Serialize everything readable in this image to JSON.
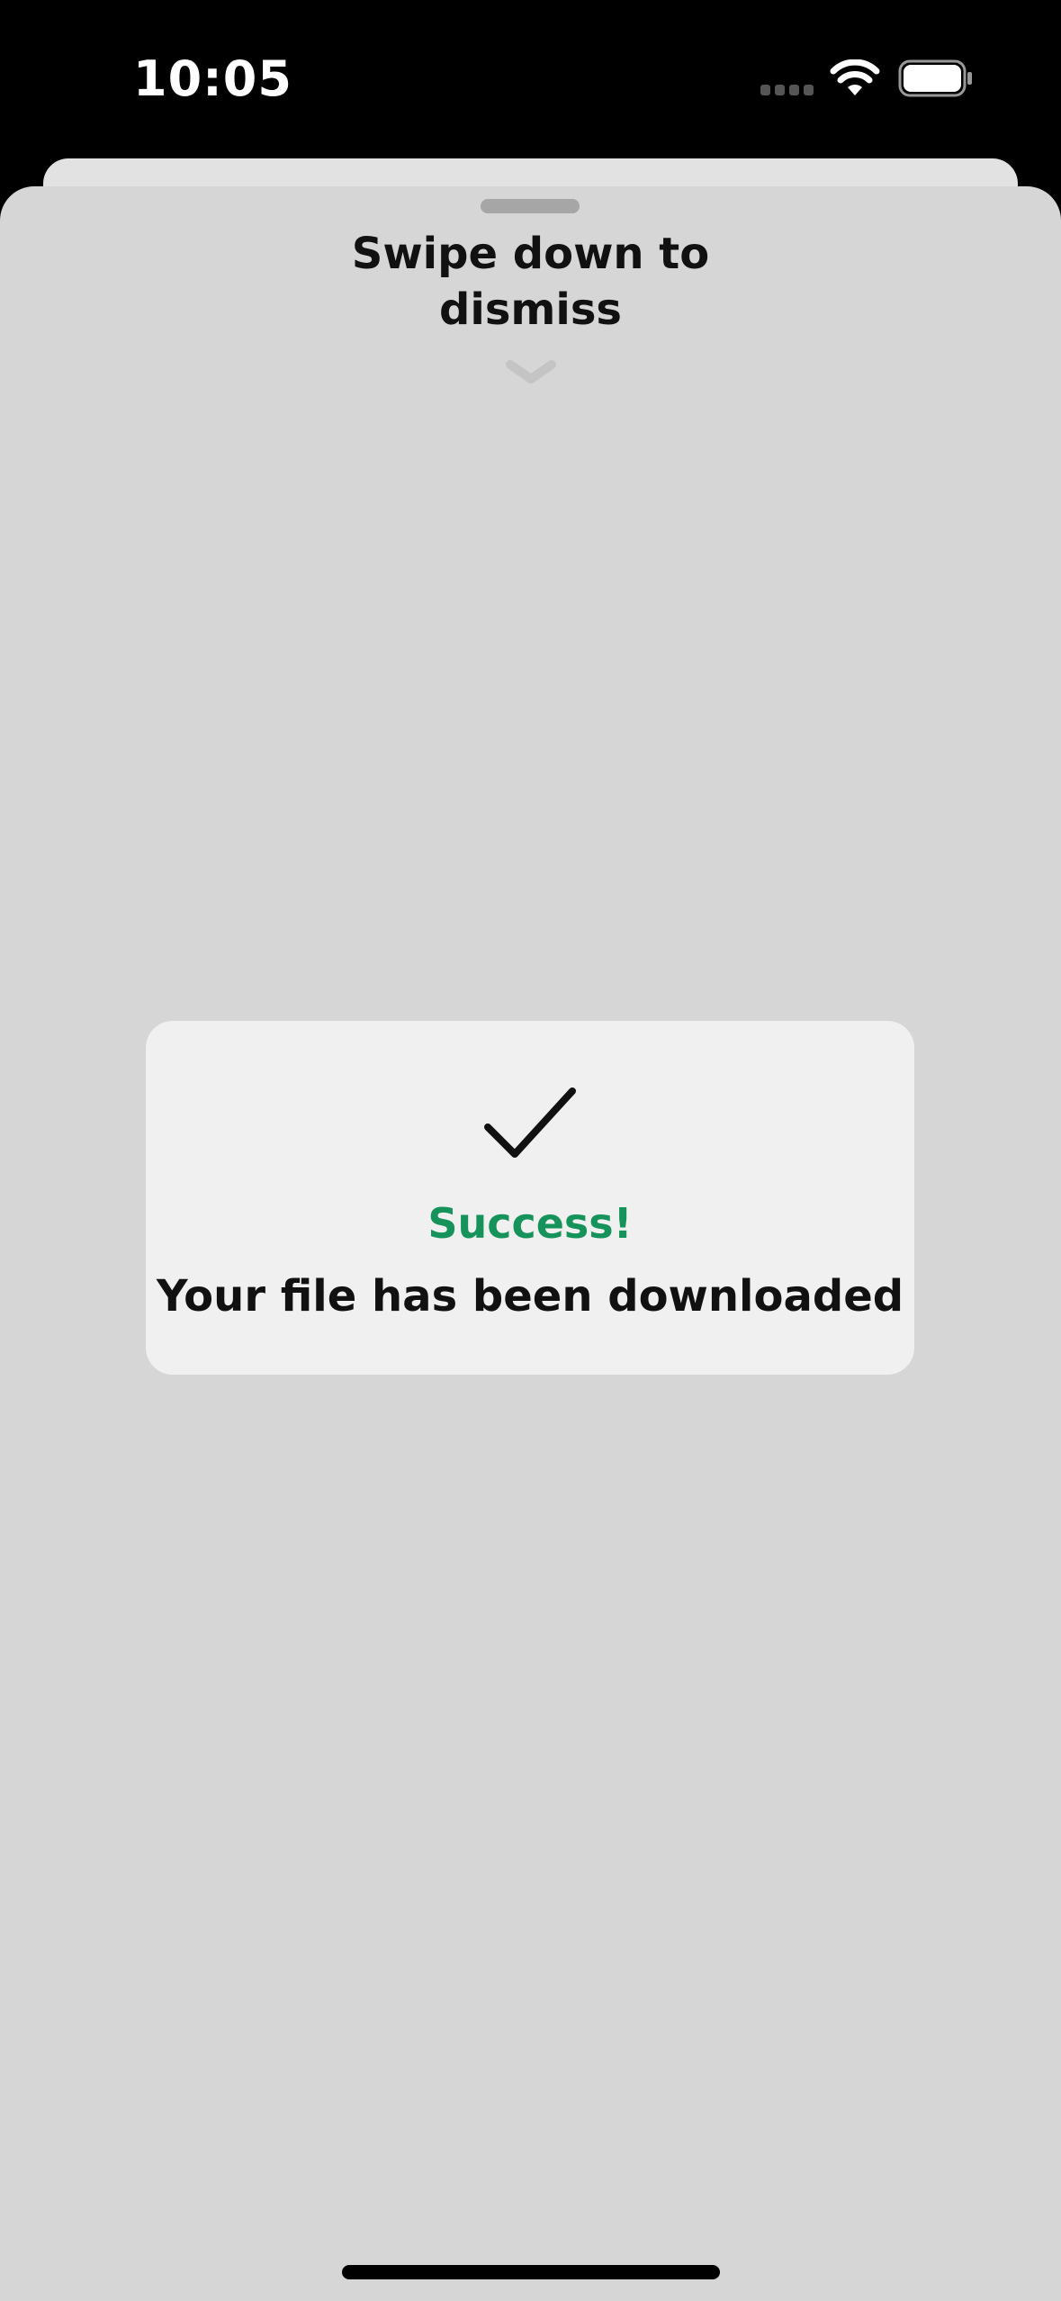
{
  "status_bar": {
    "time": "10:05",
    "icons": [
      "cellular-signal-icon",
      "wifi-icon",
      "battery-icon"
    ]
  },
  "sheet": {
    "dismiss_hint": "Swipe down to dismiss",
    "icons": [
      "grabber-handle",
      "chevron-down-icon"
    ]
  },
  "toast": {
    "icon": "checkmark-icon",
    "title": "Success!",
    "message": "Your file has been downloaded",
    "title_color": "#16935a"
  },
  "colors": {
    "status_bar_bg": "#000000",
    "sheet_bg": "#d6d6d6",
    "toast_bg": "#f0f0f0",
    "text": "#111111"
  }
}
